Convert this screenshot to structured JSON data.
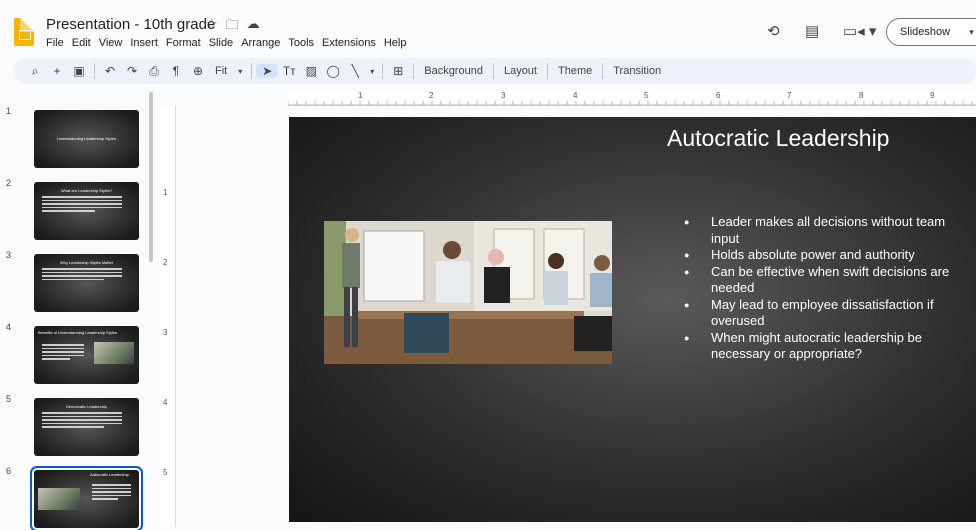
{
  "app": {
    "doc_title": "Presentation - 10th grade",
    "menu": [
      "File",
      "Edit",
      "View",
      "Insert",
      "Format",
      "Slide",
      "Arrange",
      "Tools",
      "Extensions",
      "Help"
    ],
    "slideshow_label": "Slideshow"
  },
  "toolbar": {
    "zoom_label": "Fit",
    "background_label": "Background",
    "layout_label": "Layout",
    "theme_label": "Theme",
    "transition_label": "Transition"
  },
  "ruler": {
    "top": [
      "1",
      "2",
      "3",
      "4",
      "5",
      "6",
      "7",
      "8",
      "9"
    ],
    "left": [
      "1",
      "2",
      "3",
      "4",
      "5"
    ]
  },
  "slides": [
    {
      "num": "1",
      "title": "Understanding Leadership Styles",
      "lines": 0,
      "image": false
    },
    {
      "num": "2",
      "title": "What are Leadership Styles?",
      "lines": 5,
      "image": false
    },
    {
      "num": "3",
      "title": "Why Leadership Styles Matter",
      "lines": 4,
      "image": false
    },
    {
      "num": "4",
      "title": "Benefits of Understanding Leadership Styles",
      "lines": 5,
      "image": true
    },
    {
      "num": "5",
      "title": "Democratic Leadership",
      "lines": 5,
      "image": false
    },
    {
      "num": "6",
      "title": "Autocratic Leadership",
      "lines": 5,
      "image": true
    }
  ],
  "current_slide": {
    "title": "Autocratic Leadership",
    "bullets": [
      "Leader makes all decisions without team input",
      "Holds absolute power and authority",
      "Can be effective when swift decisions are needed",
      "May lead to employee dissatisfaction if overused",
      "When might autocratic leadership be necessary or appropriate?"
    ]
  }
}
